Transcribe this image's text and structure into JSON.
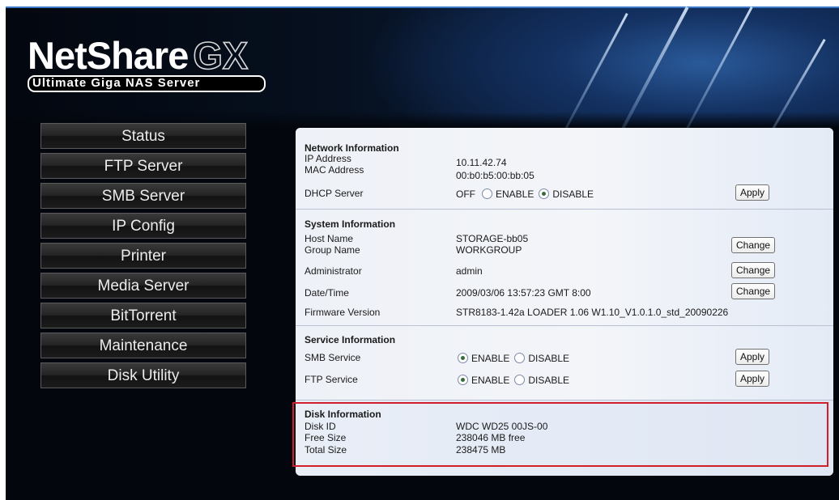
{
  "brand": {
    "name": "NetShare",
    "suffix": "GX",
    "tagline": "Ultimate Giga NAS Server"
  },
  "nav": {
    "items": [
      {
        "label": "Status"
      },
      {
        "label": "FTP Server"
      },
      {
        "label": "SMB Server"
      },
      {
        "label": "IP Config"
      },
      {
        "label": "Printer"
      },
      {
        "label": "Media Server"
      },
      {
        "label": "BitTorrent"
      },
      {
        "label": "Maintenance"
      },
      {
        "label": "Disk Utility"
      }
    ]
  },
  "network": {
    "title": "Network Information",
    "ip_label": "IP Address",
    "ip_value": "10.11.42.74",
    "mac_label": "MAC Address",
    "mac_value": "00:b0:b5:00:bb:05",
    "dhcp_label": "DHCP Server",
    "dhcp_status": "OFF",
    "enable_label": "ENABLE",
    "disable_label": "DISABLE",
    "dhcp_selected": "DISABLE",
    "apply_label": "Apply"
  },
  "system": {
    "title": "System Information",
    "host_label": "Host Name",
    "host_value": "STORAGE-bb05",
    "group_label": "Group Name",
    "group_value": "WORKGROUP",
    "admin_label": "Administrator",
    "admin_value": "admin",
    "datetime_label": "Date/Time",
    "datetime_value": "2009/03/06 13:57:23 GMT 8:00",
    "firmware_label": "Firmware Version",
    "firmware_value": "STR8183-1.42a LOADER 1.06 W1.10_V1.0.1.0_std_20090226",
    "change_label": "Change"
  },
  "service": {
    "title": "Service Information",
    "smb_label": "SMB Service",
    "smb_selected": "ENABLE",
    "ftp_label": "FTP Service",
    "ftp_selected": "ENABLE",
    "enable_label": "ENABLE",
    "disable_label": "DISABLE",
    "apply_label": "Apply"
  },
  "disk": {
    "title": "Disk Information",
    "id_label": "Disk ID",
    "id_value": "WDC WD25 00JS-00",
    "free_label": "Free Size",
    "free_value": "238046 MB free",
    "total_label": "Total Size",
    "total_value": "238475 MB"
  },
  "colors": {
    "highlight": "#d01e2a",
    "frame_top": "#3a78c8",
    "nav_bg": "#1c1c1c"
  }
}
